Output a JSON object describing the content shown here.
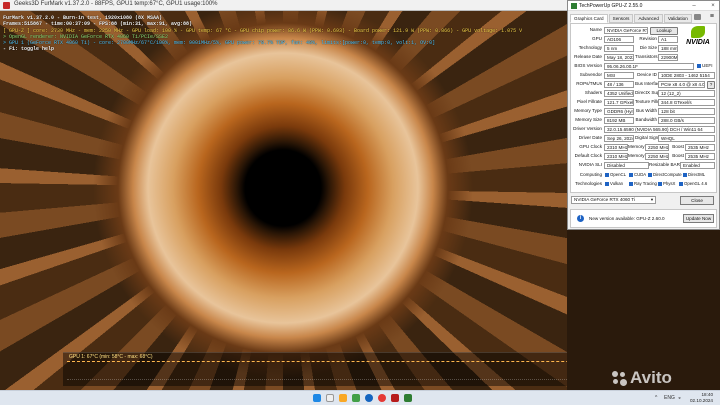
{
  "furmark": {
    "title": "Geeks3D FurMark v1.37.2.0 - 88FPS, GPU1 temp:67°C, GPU1 usage:100%",
    "overlay": [
      "FurMark v1.37.2.0 - Burn-in test, 1920x1080 (8X MSAA)",
      "Frames:515867 - time:00:37:09 - FPS:88 (min:31, max:91, avg:88)",
      "[ GPU-Z ] core: 2730 MHz - mem: 2250 MHz - GPU load: 100 % - GPU temp: 67 °C - GPU chip power: 86.6 W (PPW: 0.693) - Board power: 121.9 W (PPW: 0.866) - GPU voltage: 1.075 V",
      "> OpenGL renderer: NVIDIA GeForce RTX 4060 Ti/PCIe/SSE2",
      "> GPU 1 (GeForce RTX 4060 Ti) - core: 2700MHz/67°C/100%, mem: 9001MHz/5%, GPU power: 78.7% TDP, fan: 40%, limits:[power:0, temp:0, volt:1, OV:0]",
      "- F1: toggle help"
    ],
    "graph_label": "GPU 1: 67°C (min: 58°C - max: 68°C)"
  },
  "gpuz": {
    "title": "TechPowerUp GPU-Z 2.55.0",
    "tabs": [
      "Graphics Card",
      "Sensors",
      "Advanced",
      "Validation"
    ],
    "fields": {
      "name_label": "Name",
      "name": "NVIDIA GeForce RTX 4060 Ti",
      "lookup": "Lookup",
      "gpu_label": "GPU",
      "gpu": "AD106",
      "revision_label": "Revision",
      "revision": "A1",
      "technology_label": "Technology",
      "technology": "5 nm",
      "die_size_label": "Die Size",
      "die_size": "188 mm²",
      "release_label": "Release Date",
      "release": "May 18, 2023",
      "transistors_label": "Transistors",
      "transistors": "22900M",
      "bios_label": "BIOS Version",
      "bios": "95.06.26.00.1F",
      "uefi": "UEFI",
      "subvendor_label": "Subvendor",
      "subvendor": "MSI",
      "device_id_label": "Device ID",
      "device_id": "10DE 2803 - 1462 5154",
      "rops_label": "ROPs/TMUs",
      "rops": "48 / 136",
      "bus_label": "Bus Interface",
      "bus": "PCIe x8 4.0 @ x8 4.0",
      "shaders_label": "Shaders",
      "shaders": "4352 Unified",
      "directx_label": "DirectX Support",
      "directx": "12 (12_2)",
      "pixel_label": "Pixel Fillrate",
      "pixel": "121.7 GPixel/s",
      "texture_label": "Texture Fillrate",
      "texture": "344.8 GTexel/s",
      "memtype_label": "Memory Type",
      "memtype": "GDDR6 (Hynix)",
      "buswidth_label": "Bus Width",
      "buswidth": "128 bit",
      "memsize_label": "Memory Size",
      "memsize": "8192 MB",
      "bandwidth_label": "Bandwidth",
      "bandwidth": "288.0 GB/s",
      "driverver_label": "Driver Version",
      "driverver": "32.0.15.6590 (NVIDIA 565.90) DCH / Win11 64",
      "driverdate_label": "Driver Date",
      "driverdate": "Sep 26, 2024",
      "signature_label": "Digital Signature",
      "signature": "WHQL",
      "gpuclock_label": "GPU Clock",
      "gpuclock": "2310 MHz",
      "mem_label": "Memory",
      "gpumem": "2250 MHz",
      "boost_label": "Boost",
      "gpuboost": "2535 MHz",
      "defclock_label": "Default Clock",
      "defclock": "2310 MHz",
      "defmem": "2250 MHz",
      "defboost": "2535 MHz",
      "sli_label": "NVIDIA SLI",
      "sli": "Disabled",
      "rebar_label": "Resizable BAR",
      "rebar": "Enabled",
      "computing_label": "Computing",
      "computing": [
        "OpenCL",
        "CUDA",
        "DirectCompute",
        "DirectML"
      ],
      "tech_label": "Technologies",
      "technologies": [
        "Vulkan",
        "Ray Tracing",
        "PhysX",
        "OpenGL 4.6"
      ]
    },
    "selected_card": "NVIDIA GeForce RTX 4060 Ti",
    "close": "Close",
    "update_text": "New version available: GPU-Z 2.60.0",
    "update_button": "Update Now"
  },
  "taskbar": {
    "time": "18:40",
    "date": "02.10.2024",
    "lang": "ENG"
  },
  "watermark": "Avito"
}
